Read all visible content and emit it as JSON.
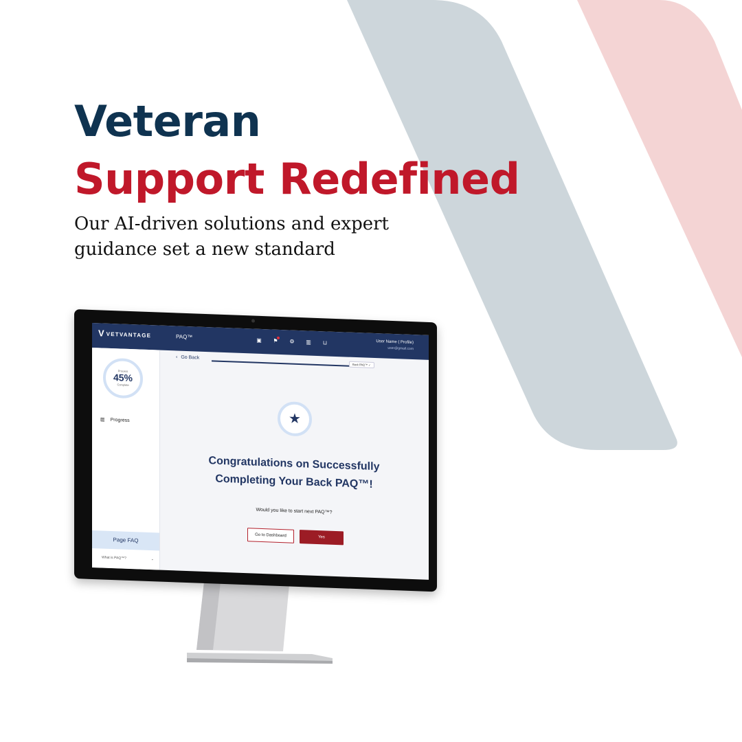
{
  "headline": {
    "line1": "Veteran",
    "line2": "Support Redefined"
  },
  "subheadline": "Our AI-driven solutions and expert guidance set a new standard",
  "colors": {
    "navy": "#0f3350",
    "red": "#c0182a",
    "app_bar": "#223663",
    "stripe_gray": "#cdd6db",
    "stripe_pink": "#f4d4d4"
  },
  "app": {
    "logo_text": "VETVANTAGE",
    "page_name": "PAQ™",
    "icons": [
      "save-icon",
      "bell-icon",
      "gear-icon",
      "book-icon",
      "cart-icon"
    ],
    "user": {
      "name": "User Name ( Profile)",
      "email": "user@gmail.com"
    },
    "sidebar": {
      "progress_top": "Process",
      "progress_value": "45%",
      "progress_bottom": "Complete",
      "progress_link": "Progress",
      "faq_header": "Page FAQ",
      "faq_question": "What is PAQ™?"
    },
    "main": {
      "go_back": "Go Back",
      "track_badge": "Back PAQ™ ✓",
      "title": "Congratulations on Successfully Completing Your Back PAQ™!",
      "question": "Would you like to start next PAQ™?",
      "btn_dashboard": "Go to Dashboard",
      "btn_yes": "Yes"
    }
  }
}
